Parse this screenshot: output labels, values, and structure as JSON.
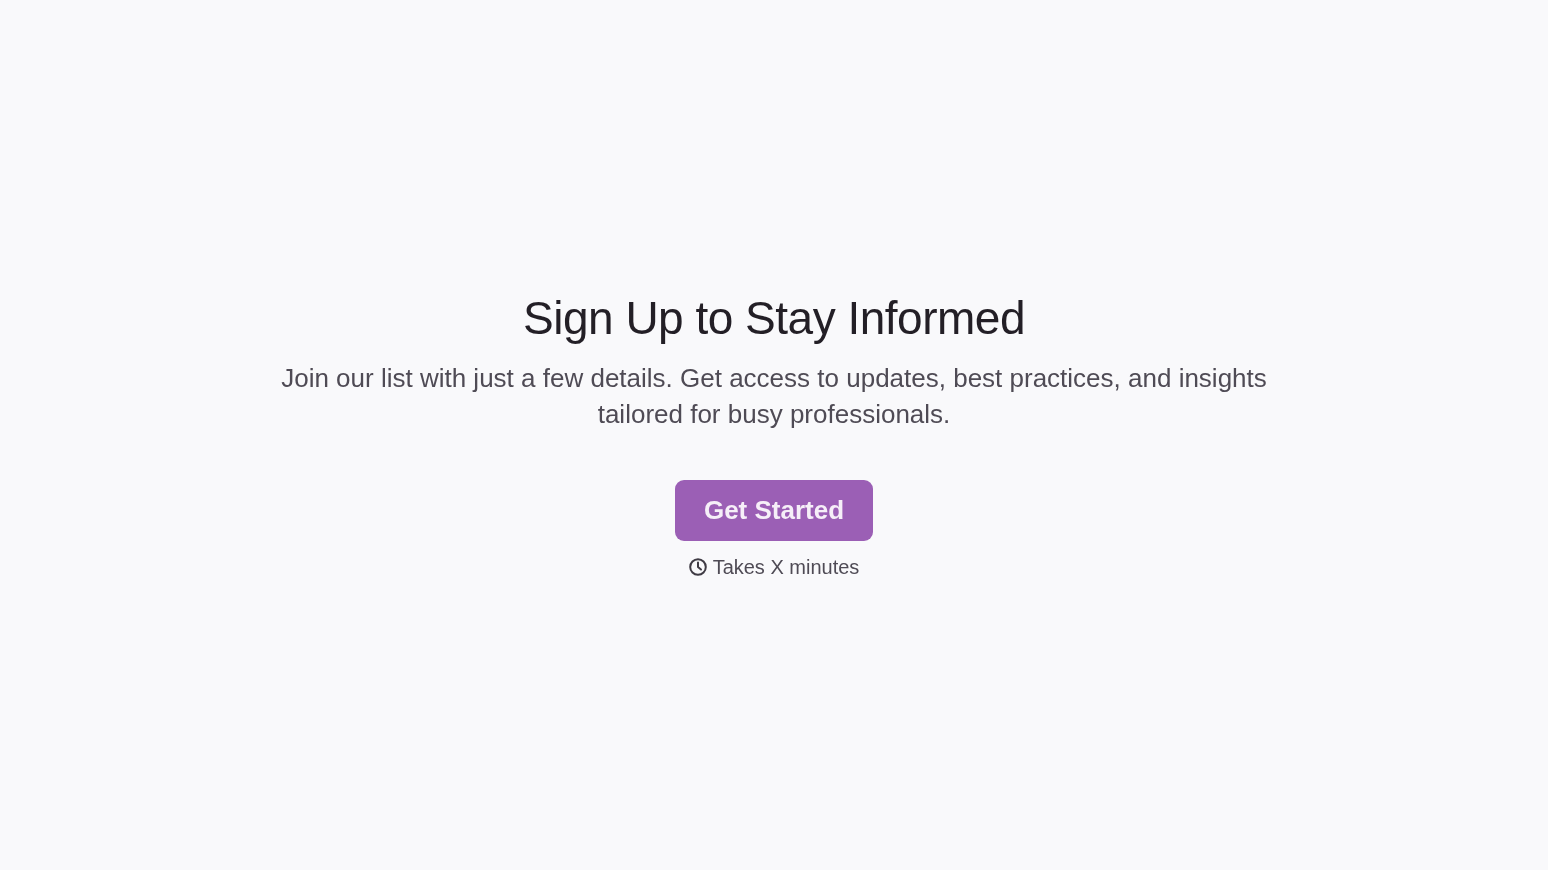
{
  "hero": {
    "title": "Sign Up to Stay Informed",
    "description": "Join our list with just a few details. Get access to updates, best practices, and insights tailored for busy professionals."
  },
  "cta": {
    "label": "Get Started",
    "note": "Takes X minutes"
  }
}
